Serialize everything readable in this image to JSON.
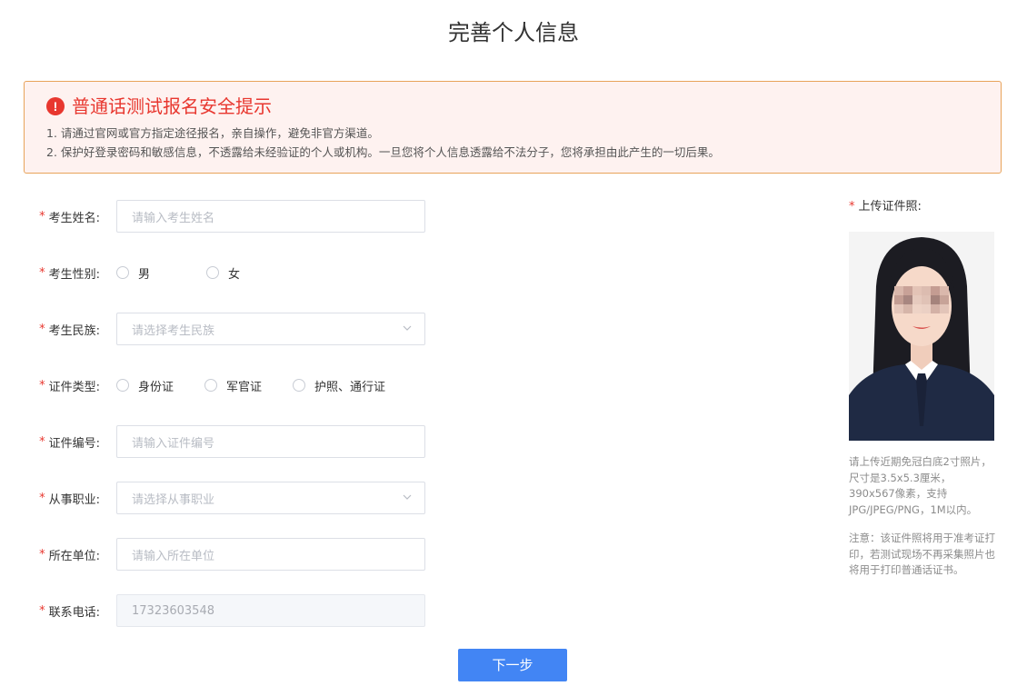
{
  "page": {
    "title": "完善个人信息"
  },
  "notice": {
    "title": "普通话测试报名安全提示",
    "lines": [
      "1. 请通过官网或官方指定途径报名，亲自操作，避免非官方渠道。",
      "2. 保护好登录密码和敏感信息，不透露给未经验证的个人或机构。一旦您将个人信息透露给不法分子，您将承担由此产生的一切后果。"
    ],
    "icon": "exclamation-circle-icon"
  },
  "form": {
    "required_mark": "*",
    "name": {
      "label": "考生姓名:",
      "placeholder": "请输入考生姓名"
    },
    "gender": {
      "label": "考生性别:",
      "options": [
        "男",
        "女"
      ]
    },
    "ethnicity": {
      "label": "考生民族:",
      "placeholder": "请选择考生民族"
    },
    "id_type": {
      "label": "证件类型:",
      "options": [
        "身份证",
        "军官证",
        "护照、通行证"
      ]
    },
    "id_number": {
      "label": "证件编号:",
      "placeholder": "请输入证件编号"
    },
    "occupation": {
      "label": "从事职业:",
      "placeholder": "请选择从事职业"
    },
    "workplace": {
      "label": "所在单位:",
      "placeholder": "请输入所在单位"
    },
    "phone": {
      "label": "联系电话:",
      "value": "17323603548"
    }
  },
  "photo": {
    "label": "上传证件照:",
    "hint": "请上传近期免冠白底2寸照片，尺寸是3.5x5.3厘米，390x567像素，支持JPG/JPEG/PNG，1M以内。",
    "note": "注意：该证件照将用于准考证打印，若测试现场不再采集照片也将用于打印普通话证书。"
  },
  "actions": {
    "next_label": "下一步"
  },
  "colors": {
    "accent": "#4285f4",
    "danger": "#e8372f",
    "notice_bg": "#fef2f0",
    "notice_border": "#e8a35a"
  }
}
